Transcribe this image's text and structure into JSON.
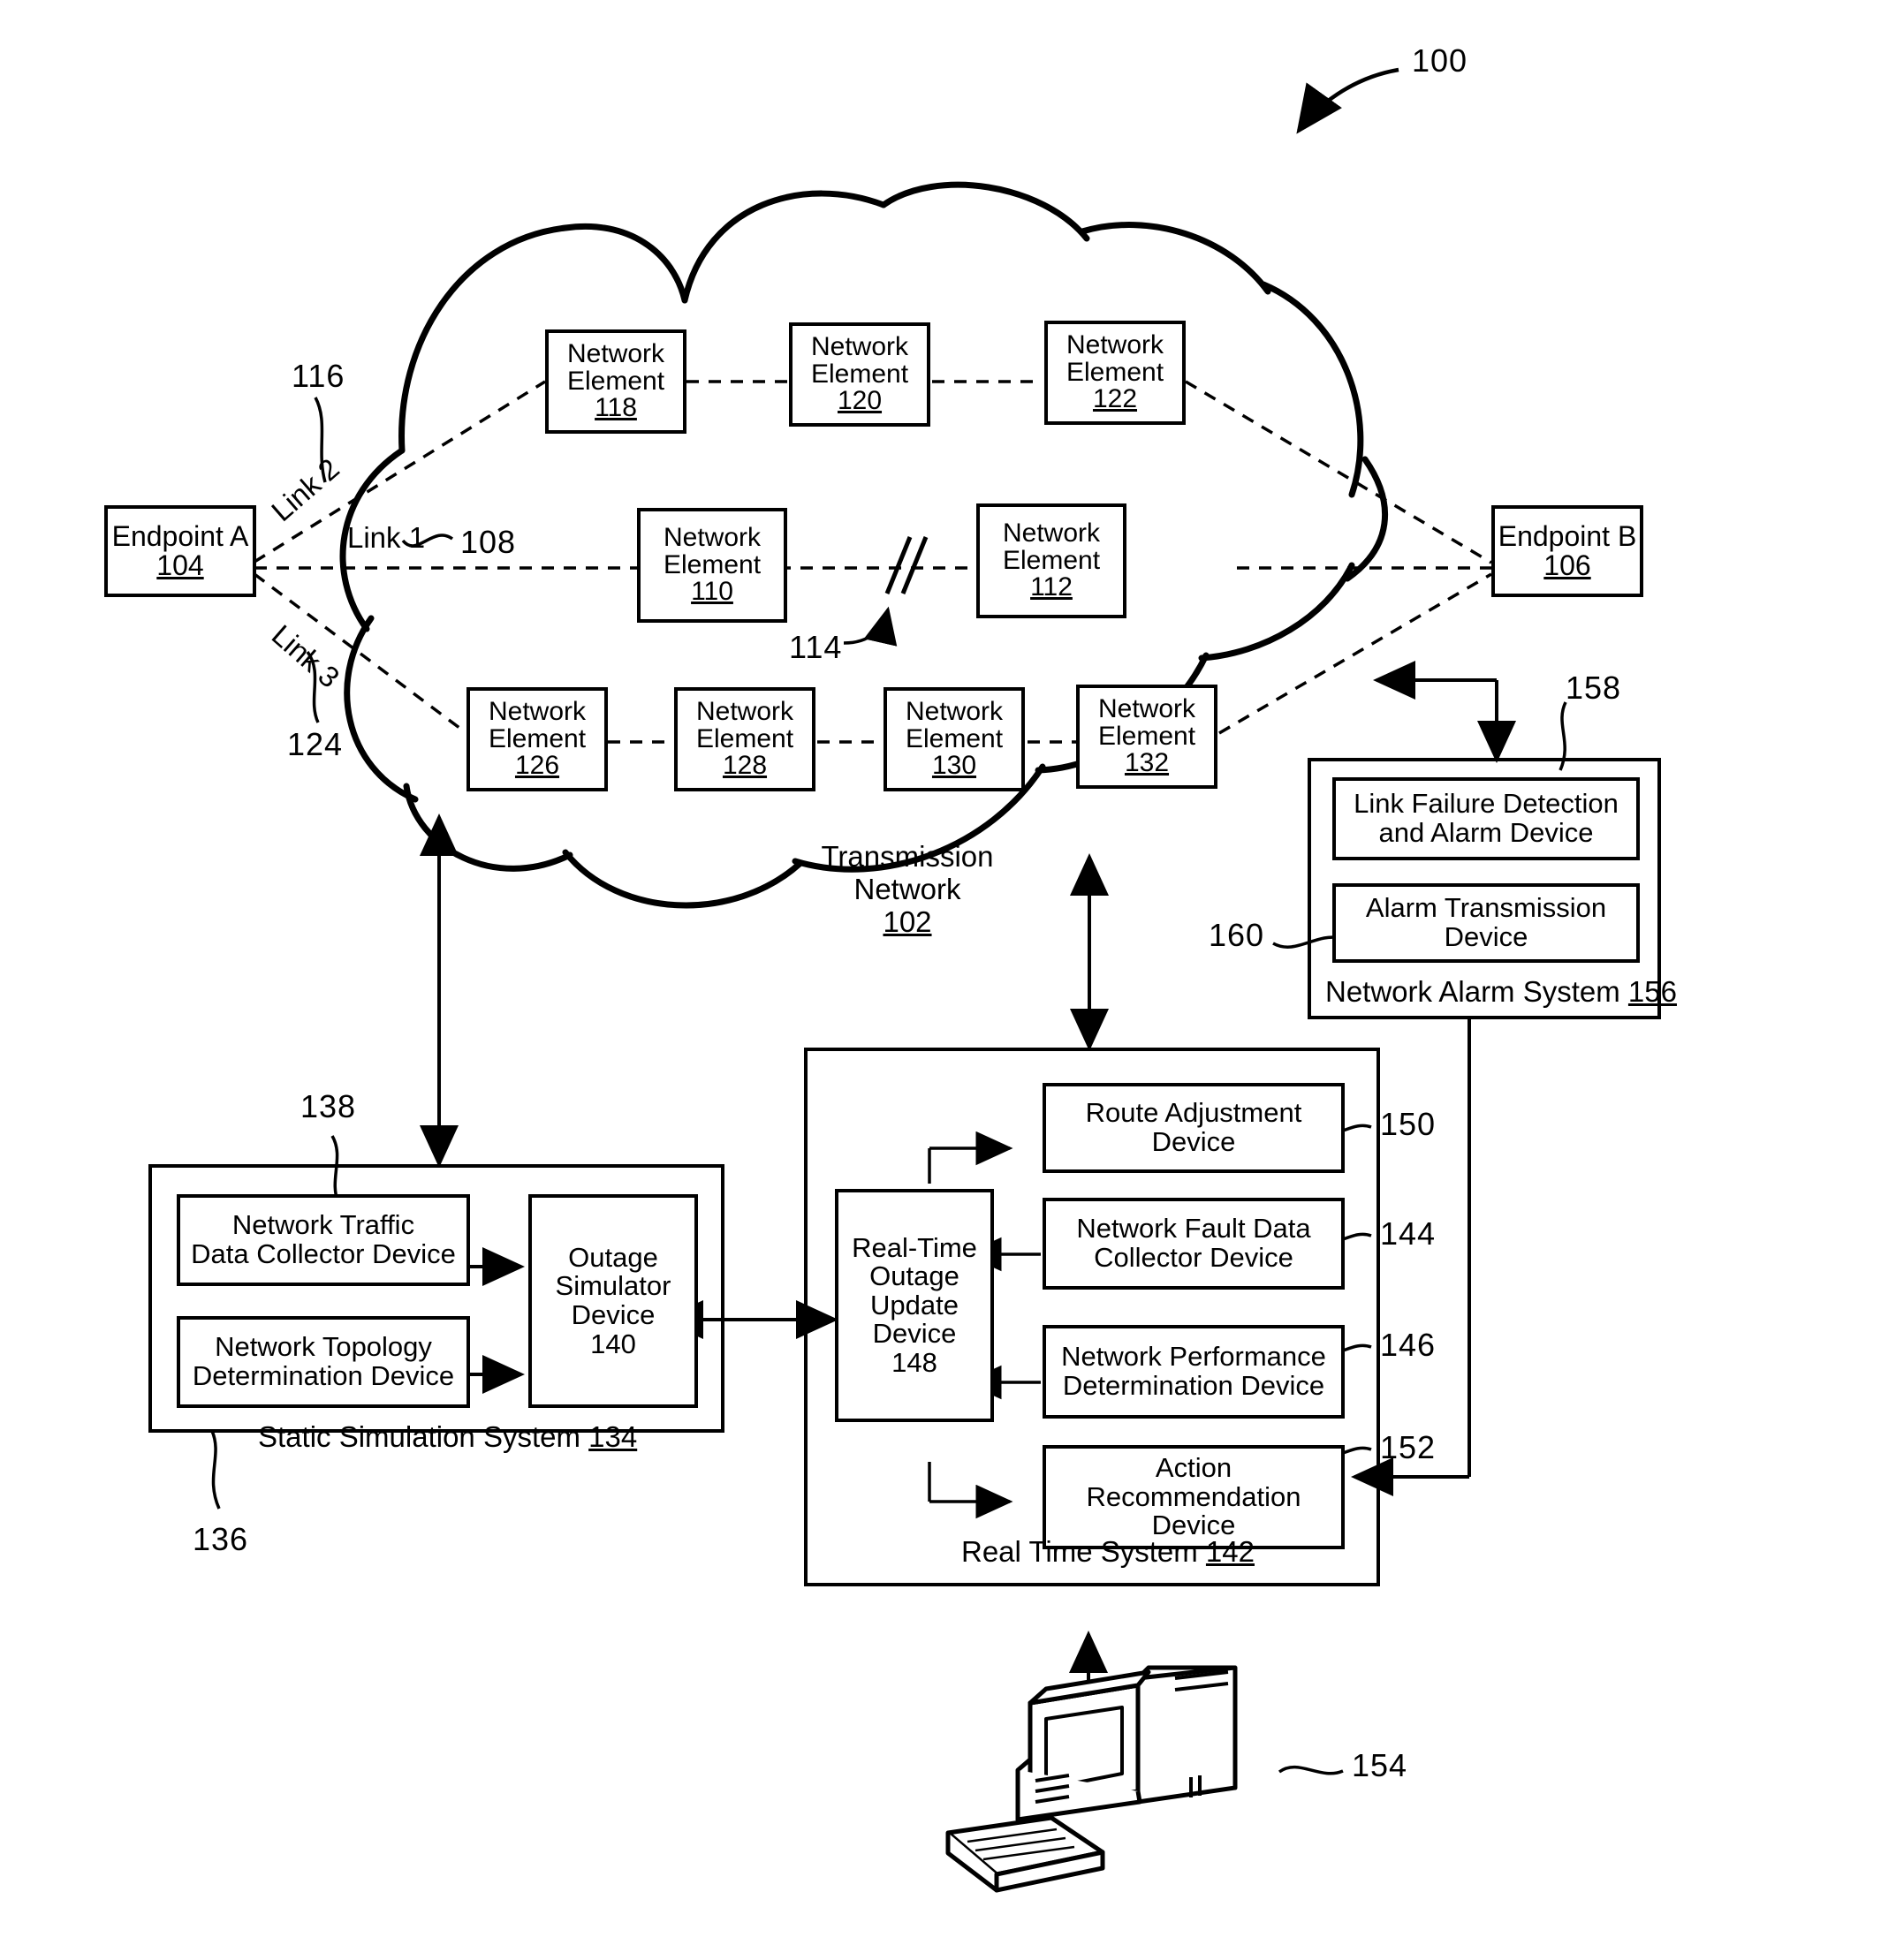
{
  "figure": {
    "figure_ref": "100"
  },
  "network_cloud": {
    "label_line1": "Transmission",
    "label_line2": "Network",
    "ref": "102"
  },
  "endpoints": [
    {
      "name": "endpoint-a",
      "label": "Endpoint A",
      "ref": "104"
    },
    {
      "name": "endpoint-b",
      "label": "Endpoint B",
      "ref": "106"
    }
  ],
  "links": [
    {
      "name": "link-1",
      "label": "Link 1",
      "ref": "108"
    },
    {
      "name": "link-2",
      "label": "Link 2",
      "ref": "116"
    },
    {
      "name": "link-3",
      "label": "Link 3",
      "ref": "124"
    }
  ],
  "break_marker": {
    "ref": "114"
  },
  "network_elements": [
    {
      "line1": "Network",
      "line2": "Element",
      "ref": "118"
    },
    {
      "line1": "Network",
      "line2": "Element",
      "ref": "120"
    },
    {
      "line1": "Network",
      "line2": "Element",
      "ref": "122"
    },
    {
      "line1": "Network",
      "line2": "Element",
      "ref": "110"
    },
    {
      "line1": "Network",
      "line2": "Element",
      "ref": "112"
    },
    {
      "line1": "Network",
      "line2": "Element",
      "ref": "126"
    },
    {
      "line1": "Network",
      "line2": "Element",
      "ref": "128"
    },
    {
      "line1": "Network",
      "line2": "Element",
      "ref": "130"
    },
    {
      "line1": "Network",
      "line2": "Element",
      "ref": "132"
    }
  ],
  "network_alarm_system": {
    "title": "Network Alarm System",
    "ref": "156",
    "devices": [
      {
        "line1": "Link Failure Detection",
        "line2": "and Alarm Device",
        "ref": "158"
      },
      {
        "line1": "Alarm Transmission",
        "line2": "Device",
        "ref": "160"
      }
    ]
  },
  "static_simulation_system": {
    "title": "Static Simulation System",
    "ref": "134",
    "system_ref": "136",
    "collector_ref": "138",
    "devices": [
      {
        "line1": "Network Traffic",
        "line2": "Data Collector Device"
      },
      {
        "line1": "Network Topology",
        "line2": "Determination Device"
      },
      {
        "line1": "Outage",
        "line2": "Simulator",
        "line3": "Device",
        "ref": "140"
      }
    ]
  },
  "real_time_system": {
    "title": "Real Time System",
    "ref": "142",
    "devices": [
      {
        "line1": "Route Adjustment",
        "line2": "Device",
        "ref": "150"
      },
      {
        "line1": "Network Fault Data",
        "line2": "Collector Device",
        "ref": "144"
      },
      {
        "line1": "Network Performance",
        "line2": "Determination Device",
        "ref": "146"
      },
      {
        "line1": "Action",
        "line2": "Recommendation",
        "line3": "Device",
        "ref": "152"
      },
      {
        "line1": "Real-Time",
        "line2": "Outage",
        "line3": "Update",
        "line4": "Device",
        "ref": "148"
      }
    ]
  },
  "workstation": {
    "name": "computer-terminal",
    "ref": "154"
  }
}
